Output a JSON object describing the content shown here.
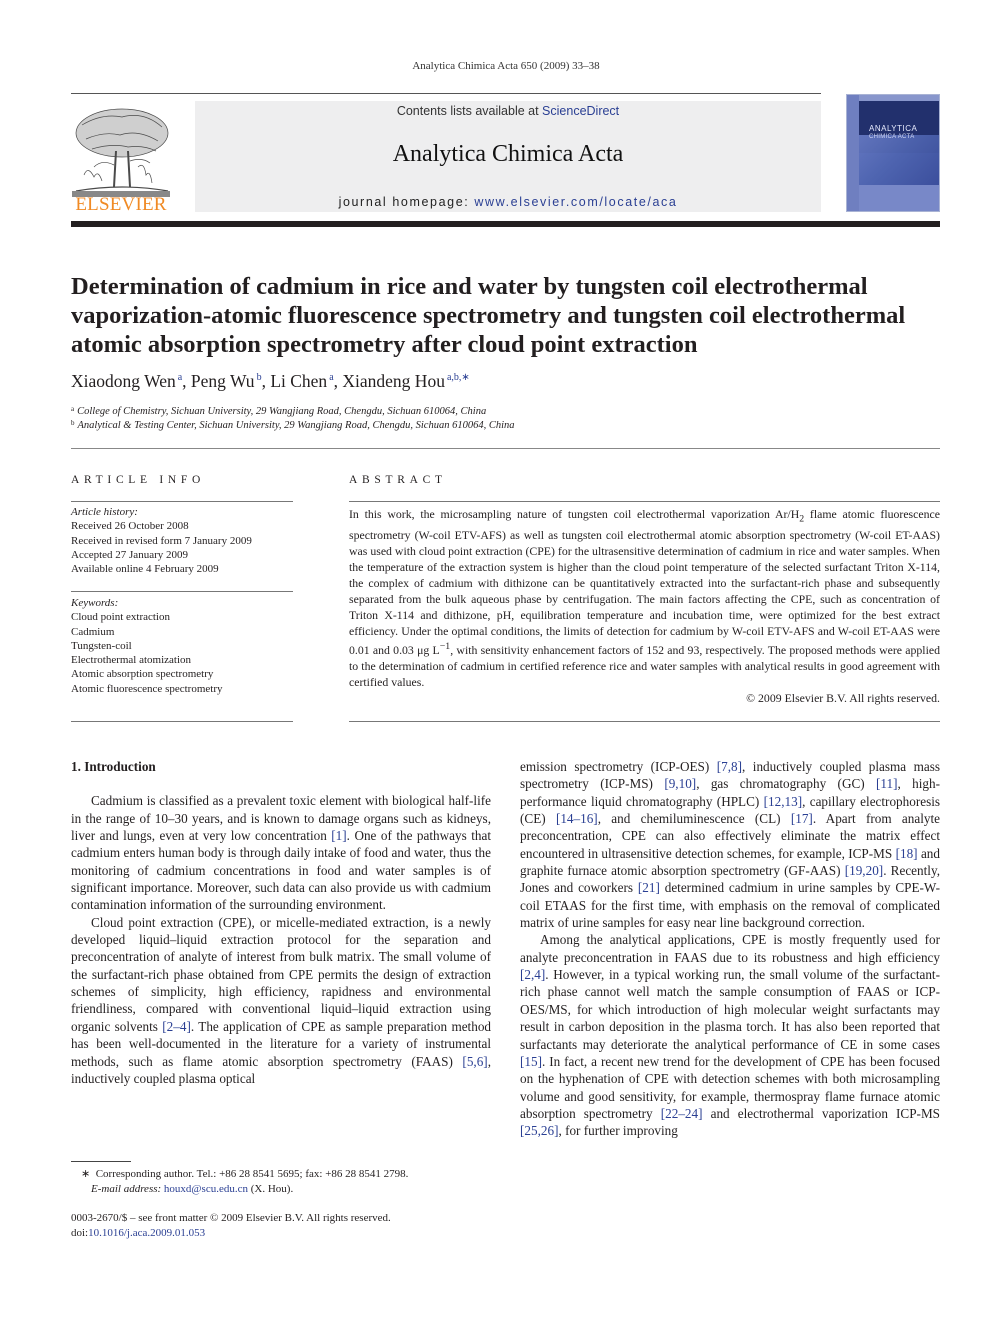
{
  "running_head": "Analytica Chimica Acta 650 (2009) 33–38",
  "publisher": {
    "logo_text": "ELSEVIER",
    "logo_color": "#f08a24"
  },
  "header": {
    "contents_prefix": "Contents lists available at ",
    "contents_link": "ScienceDirect",
    "journal_name": "Analytica Chimica Acta",
    "homepage_prefix": "journal homepage: ",
    "homepage_url": "www.elsevier.com/locate/aca",
    "link_color": "#2a3f93"
  },
  "cover": {
    "title_line1": "ANALYTICA",
    "title_line2": "CHIMICA ACTA"
  },
  "article": {
    "title": "Determination of cadmium in rice and water by tungsten coil electrothermal vaporization-atomic fluorescence spectrometry and tungsten coil electrothermal atomic absorption spectrometry after cloud point extraction",
    "authors": [
      {
        "name": "Xiaodong Wen",
        "sup": "a"
      },
      {
        "name": "Peng Wu",
        "sup": "b"
      },
      {
        "name": "Li Chen",
        "sup": "a"
      },
      {
        "name": "Xiandeng Hou",
        "sup": "a,b,∗"
      }
    ],
    "affiliations": [
      {
        "key": "a",
        "text": "College of Chemistry, Sichuan University, 29 Wangjiang Road, Chengdu, Sichuan 610064, China"
      },
      {
        "key": "b",
        "text": "Analytical & Testing Center, Sichuan University, 29 Wangjiang Road, Chengdu, Sichuan 610064, China"
      }
    ]
  },
  "article_info": {
    "heading": "ARTICLE INFO",
    "history_label": "Article history:",
    "history": [
      "Received 26 October 2008",
      "Received in revised form 7 January 2009",
      "Accepted 27 January 2009",
      "Available online 4 February 2009"
    ],
    "keywords_label": "Keywords:",
    "keywords": [
      "Cloud point extraction",
      "Cadmium",
      "Tungsten-coil",
      "Electrothermal atomization",
      "Atomic absorption spectrometry",
      "Atomic fluorescence spectrometry"
    ]
  },
  "abstract": {
    "heading": "ABSTRACT",
    "text_part1": "In this work, the microsampling nature of tungsten coil electrothermal vaporization Ar/H",
    "text_sub": "2",
    "text_part2": " flame atomic fluorescence spectrometry (W-coil ETV-AFS) as well as tungsten coil electrothermal atomic absorption spectrometry (W-coil ET-AAS) was used with cloud point extraction (CPE) for the ultrasensitive determination of cadmium in rice and water samples. When the temperature of the extraction system is higher than the cloud point temperature of the selected surfactant Triton X-114, the complex of cadmium with dithizone can be quantitatively extracted into the surfactant-rich phase and subsequently separated from the bulk aqueous phase by centrifugation. The main factors affecting the CPE, such as concentration of Triton X-114 and dithizone, pH, equilibration temperature and incubation time, were optimized for the best extract efficiency. Under the optimal conditions, the limits of detection for cadmium by W-coil ETV-AFS and W-coil ET-AAS were 0.01 and 0.03 μg L",
    "text_sup": "−1",
    "text_part3": ", with sensitivity enhancement factors of 152 and 93, respectively. The proposed methods were applied to the determination of cadmium in certified reference rice and water samples with analytical results in good agreement with certified values.",
    "copyright": "© 2009 Elsevier B.V. All rights reserved."
  },
  "introduction": {
    "heading": "1.  Introduction",
    "p1": [
      {
        "t": "Cadmium is classified as a prevalent toxic element with biolog­ical half-life in the range of 10–30 years, and is known to damage organs such as kidneys, liver and lungs, even at very low concen­tration "
      },
      {
        "r": "[1]"
      },
      {
        "t": ". One of the pathways that cadmium enters human body is through daily intake of food and water, thus the monitoring of cadmium concentrations in food and water samples is of significant importance. Moreover, such data can also provide us with cadmium contamination information of the surrounding environment."
      }
    ],
    "p2": [
      {
        "t": "Cloud point extraction (CPE), or micelle-mediated extraction, is a newly developed liquid–liquid extraction protocol for the separation and preconcentration of analyte of interest from bulk matrix. The small volume of the surfactant-rich phase obtained from CPE permits the design of extraction schemes of simplicity, high efficiency, rapidness and environmental friendliness, com­pared with conventional liquid–liquid extraction using organic solvents "
      },
      {
        "r": "[2–4]"
      },
      {
        "t": ". The application of CPE as sample preparation method has been well-documented in the literature for a vari­ety of instrumental methods, such as flame atomic absorption spectrometry (FAAS) "
      },
      {
        "r": "[5,6]"
      },
      {
        "t": ", inductively coupled plasma optical emission spectrometry (ICP-OES) "
      },
      {
        "r": "[7,8]"
      },
      {
        "t": ", inductively coupled plasma mass spectrometry (ICP-MS) "
      },
      {
        "r": "[9,10]"
      },
      {
        "t": ", gas chromatography (GC) "
      },
      {
        "r": "[11]"
      },
      {
        "t": ", high-performance liquid chromatography (HPLC) "
      },
      {
        "r": "[12,13]"
      },
      {
        "t": ", capillary electrophoresis (CE) "
      },
      {
        "r": "[14–16]"
      },
      {
        "t": ", and chemiluminescence (CL) "
      },
      {
        "r": "[17]"
      },
      {
        "t": ". Apart from analyte preconcentration, CPE can also effectively elim­inate the matrix effect encountered in ultrasensitive detection schemes, for example, ICP-MS "
      },
      {
        "r": "[18]"
      },
      {
        "t": " and graphite furnace atomic absorption spectrometry (GF-AAS) "
      },
      {
        "r": "[19,20]"
      },
      {
        "t": ". Recently, Jones and coworkers "
      },
      {
        "r": "[21]"
      },
      {
        "t": " determined cadmium in urine samples by CPE-W-coil ETAAS for the first time, with emphasis on the removal of complicated matrix of urine samples for easy near line background correction."
      }
    ],
    "p3": [
      {
        "t": "Among the analytical applications, CPE is mostly frequently used for analyte preconcentration in FAAS due to its robustness and high efficiency "
      },
      {
        "r": "[2,4]"
      },
      {
        "t": ". However, in a typical working run, the small vol­ume of the surfactant-rich phase cannot well match the sample consumption of FAAS or ICP-OES/MS, for which introduction of high molecular weight surfactants may result in carbon deposition in the plasma torch. It has also been reported that surfactants may dete­riorate the analytical performance of CE in some cases "
      },
      {
        "r": "[15]"
      },
      {
        "t": ". In fact, a recent new trend for the development of CPE has been focused on the hyphenation of CPE with detection schemes with both microsampling volume and good sensitivity, for example, thermo­spray flame furnace atomic absorption spectrometry "
      },
      {
        "r": "[22–24]"
      },
      {
        "t": " and electrothermal vaporization ICP-MS "
      },
      {
        "r": "[25,26]"
      },
      {
        "t": ", for further improving"
      }
    ]
  },
  "footnote": {
    "marker": "∗",
    "corresponding": "Corresponding author. Tel.: +86 28 8541 5695; fax: +86 28 8541 2798.",
    "email_label": "E-mail address:",
    "email": "houxd@scu.edu.cn",
    "email_suffix": " (X. Hou)."
  },
  "front_matter": {
    "issn_line": "0003-2670/$ – see front matter © 2009 Elsevier B.V. All rights reserved.",
    "doi_prefix": "doi:",
    "doi": "10.1016/j.aca.2009.01.053"
  }
}
